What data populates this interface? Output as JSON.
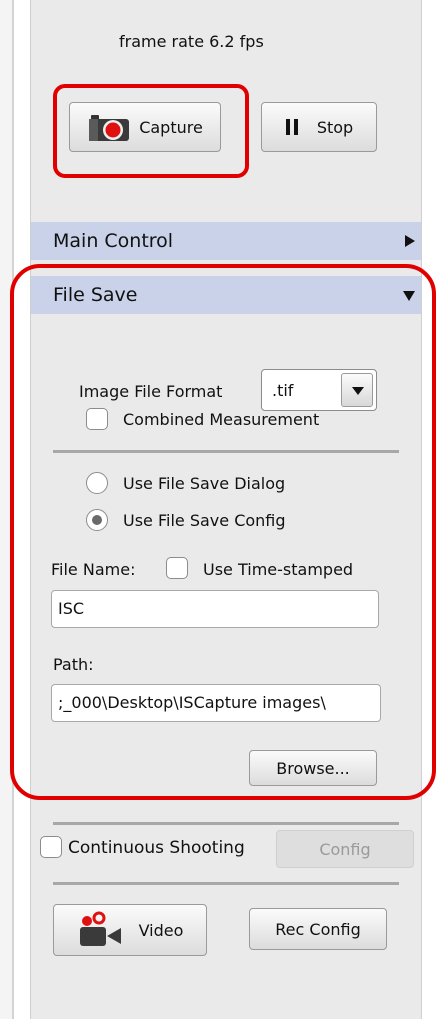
{
  "status": {
    "frame_rate": "frame rate 6.2 fps"
  },
  "buttons": {
    "capture": "Capture",
    "stop": "Stop",
    "browse": "Browse...",
    "config": "Config",
    "video": "Video",
    "rec_config": "Rec Config"
  },
  "sections": {
    "main_control": "Main Control",
    "file_save": "File Save"
  },
  "file_save": {
    "image_format_label": "Image File Format",
    "image_format_value": ".tif",
    "combined_measurement": "Combined Measurement",
    "radio_dialog": "Use File Save Dialog",
    "radio_config": "Use File Save Config",
    "file_name_label": "File Name:",
    "use_timestamp": "Use Time-stamped",
    "file_name_value": "ISC",
    "path_label": "Path:",
    "path_value": ";_000\\Desktop\\ISCapture images\\"
  },
  "bottom": {
    "continuous_shooting": "Continuous Shooting"
  },
  "colors": {
    "highlight": "#e00000",
    "section_header": "#c9d2e8",
    "panel": "#eaeaea"
  }
}
